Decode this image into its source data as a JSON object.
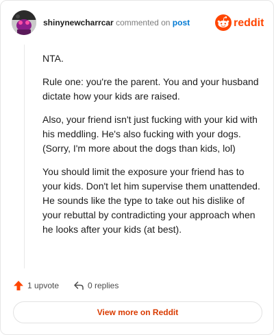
{
  "header": {
    "username": "shinynewcharrcar",
    "action_text": "commented on",
    "post_link": "post",
    "brand_wordmark": "reddit",
    "brand_color": "#ff4500"
  },
  "comment": {
    "paragraphs": [
      "NTA.",
      "Rule one: you're the parent. You and your husband dictate how your kids are raised.",
      "Also, your friend isn't just fucking with your kid with his meddling. He's also fucking with your dogs. (Sorry, I'm more about the dogs than kids, lol)",
      "You should limit the exposure your friend has to your kids. Don't let him supervise them unattended. He sounds like the type to take out his dislike of your rebuttal by contradicting your approach when he looks after your kids (at best)."
    ]
  },
  "footer": {
    "upvote_icon": "upvote-arrow-icon",
    "upvote_label": "1 upvote",
    "reply_icon": "reply-arrow-icon",
    "replies_label": "0 replies",
    "view_more_label": "View more on Reddit",
    "accent_color": "#d93a00"
  }
}
